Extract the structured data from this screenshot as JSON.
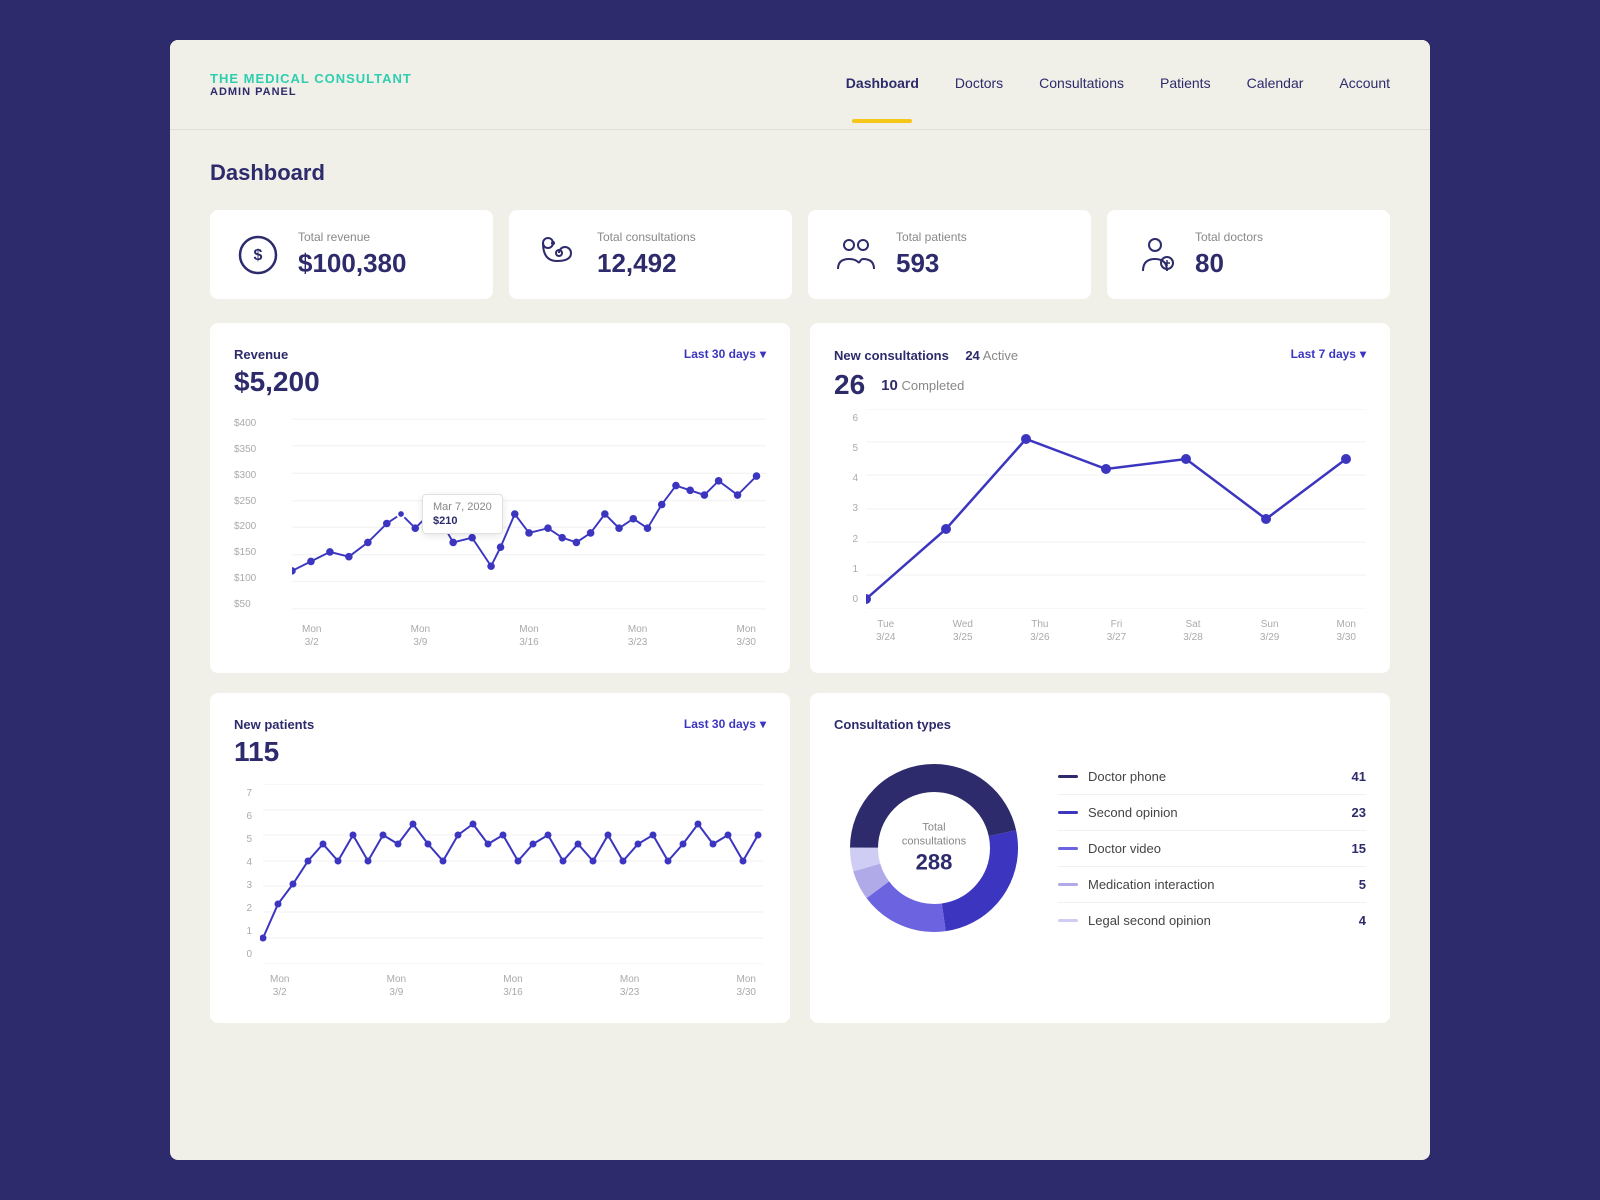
{
  "app": {
    "logo_title": "THE MEDICAL CONSULTANT",
    "logo_sub": "ADMIN PANEL"
  },
  "nav": {
    "items": [
      {
        "id": "dashboard",
        "label": "Dashboard",
        "active": true
      },
      {
        "id": "doctors",
        "label": "Doctors",
        "active": false
      },
      {
        "id": "consultations",
        "label": "Consultations",
        "active": false
      },
      {
        "id": "patients",
        "label": "Patients",
        "active": false
      },
      {
        "id": "calendar",
        "label": "Calendar",
        "active": false
      },
      {
        "id": "account",
        "label": "Account",
        "active": false
      }
    ]
  },
  "page": {
    "title": "Dashboard"
  },
  "stats": [
    {
      "id": "revenue",
      "label": "Total revenue",
      "value": "$100,380",
      "icon": "dollar"
    },
    {
      "id": "consultations",
      "label": "Total consultations",
      "value": "12,492",
      "icon": "stethoscope"
    },
    {
      "id": "patients",
      "label": "Total patients",
      "value": "593",
      "icon": "patients"
    },
    {
      "id": "doctors",
      "label": "Total doctors",
      "value": "80",
      "icon": "doctors"
    }
  ],
  "revenue_chart": {
    "title": "Revenue",
    "value": "$5,200",
    "filter": "Last 30 days",
    "tooltip": {
      "date": "Mar 7, 2020",
      "value": "$210"
    },
    "x_labels": [
      {
        "line1": "Mon",
        "line2": "3/2"
      },
      {
        "line1": "Mon",
        "line2": "3/9"
      },
      {
        "line1": "Mon",
        "line2": "3/16"
      },
      {
        "line1": "Mon",
        "line2": "3/23"
      },
      {
        "line1": "Mon",
        "line2": "3/30"
      }
    ],
    "y_labels": [
      "$400",
      "$350",
      "$300",
      "$250",
      "$200",
      "$150",
      "$100",
      "$50"
    ]
  },
  "consultations_chart": {
    "title": "New consultations",
    "value": "26",
    "active_label": "Active",
    "active_value": "24",
    "completed_label": "Completed",
    "completed_value": "10",
    "filter": "Last 7 days",
    "x_labels": [
      {
        "line1": "Tue",
        "line2": "3/24"
      },
      {
        "line1": "Wed",
        "line2": "3/25"
      },
      {
        "line1": "Thu",
        "line2": "3/26"
      },
      {
        "line1": "Fri",
        "line2": "3/27"
      },
      {
        "line1": "Sat",
        "line2": "3/28"
      },
      {
        "line1": "Sun",
        "line2": "3/29"
      },
      {
        "line1": "Mon",
        "line2": "3/30"
      }
    ]
  },
  "patients_chart": {
    "title": "New patients",
    "value": "115",
    "filter": "Last 30 days",
    "x_labels": [
      {
        "line1": "Mon",
        "line2": "3/2"
      },
      {
        "line1": "Mon",
        "line2": "3/9"
      },
      {
        "line1": "Mon",
        "line2": "3/16"
      },
      {
        "line1": "Mon",
        "line2": "3/23"
      },
      {
        "line1": "Mon",
        "line2": "3/30"
      }
    ]
  },
  "consultation_types": {
    "title": "Consultation types",
    "donut_label": "Total consultations",
    "donut_value": "288",
    "legend": [
      {
        "label": "Doctor phone",
        "value": "41",
        "color": "#2d2b6b"
      },
      {
        "label": "Second opinion",
        "value": "23",
        "color": "#3b35c0"
      },
      {
        "label": "Doctor video",
        "value": "15",
        "color": "#6b63e0"
      },
      {
        "label": "Medication interaction",
        "value": "5",
        "color": "#b0aae8"
      },
      {
        "label": "Legal second opinion",
        "value": "4",
        "color": "#d0cdf5"
      }
    ],
    "donut_segments": [
      {
        "label": "Doctor phone",
        "value": 41,
        "color": "#2d2b6b",
        "offset": 0
      },
      {
        "label": "Second opinion",
        "value": 23,
        "color": "#3b35c0",
        "offset": 41
      },
      {
        "label": "Doctor video",
        "value": 15,
        "color": "#6b63e0",
        "offset": 64
      },
      {
        "label": "Medication interaction",
        "value": 5,
        "color": "#b0aae8",
        "offset": 79
      },
      {
        "label": "Legal second opinion",
        "value": 4,
        "color": "#d0cdf5",
        "offset": 84
      }
    ]
  },
  "colors": {
    "brand": "#2d2b6b",
    "accent": "#2ecfb0",
    "yellow": "#f5c518",
    "line": "#3b35c0"
  }
}
